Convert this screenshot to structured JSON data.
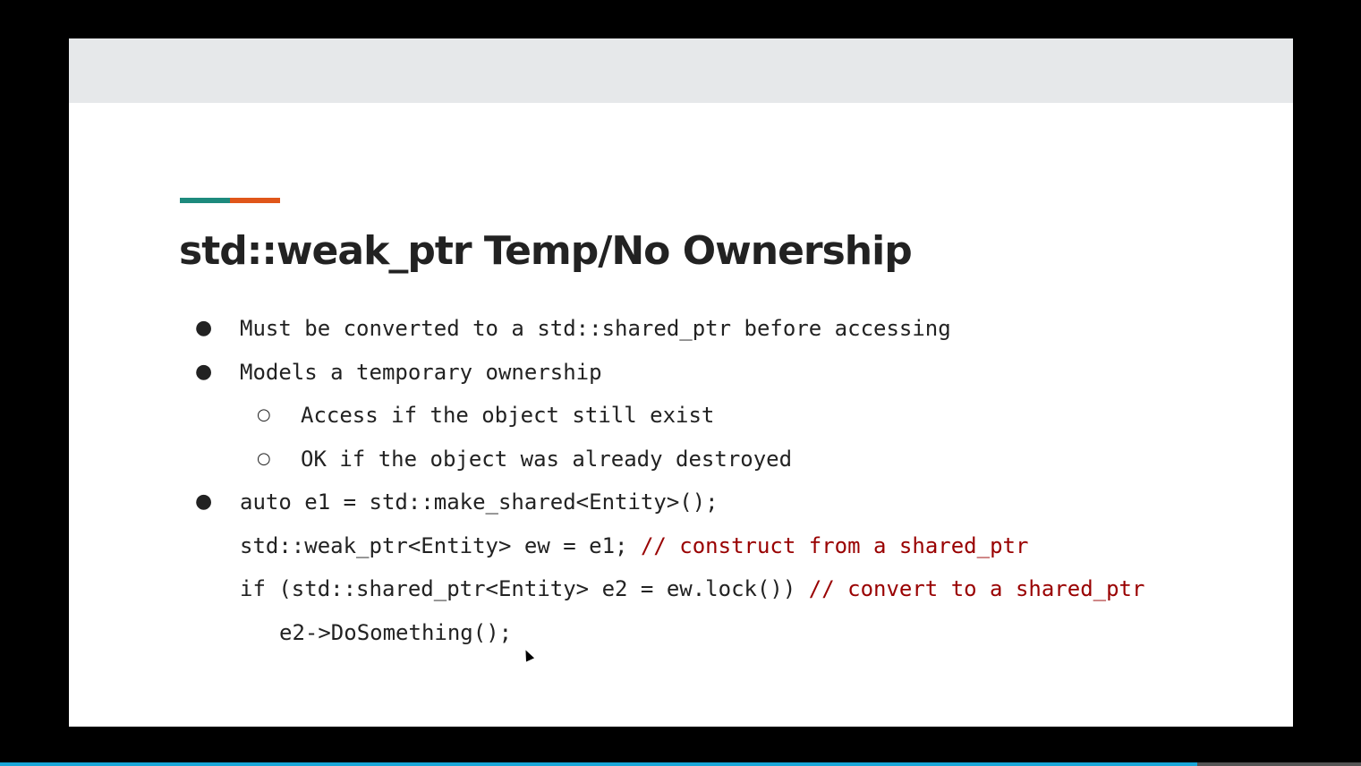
{
  "slide": {
    "title": "std::weak_ptr Temp/No Ownership",
    "bullets": [
      {
        "marker": "●",
        "text": "Must be converted to a std::shared_ptr before accessing"
      },
      {
        "marker": "●",
        "text": "Models a temporary ownership"
      },
      {
        "marker": "○",
        "text": "Access if the object still exist"
      },
      {
        "marker": "○",
        "text": "OK if the object was already destroyed"
      },
      {
        "marker": "●",
        "text": "auto e1 = std::make_shared<Entity>();"
      }
    ],
    "code": [
      {
        "code": "std::weak_ptr<Entity> ew = e1; ",
        "comment": "// construct from a shared_ptr"
      },
      {
        "code": "if (std::shared_ptr<Entity> e2 = ew.lock()) ",
        "comment": "// convert to a shared_ptr"
      },
      {
        "code": "e2->DoSomething();",
        "comment": ""
      }
    ]
  },
  "colors": {
    "accent_teal": "#1d8a7d",
    "accent_orange": "#e0561a",
    "comment_red": "#990000",
    "progress_blue": "#1aa7d9"
  },
  "icons": {
    "cursor": "mouse-pointer-icon"
  },
  "video_progress": {
    "fraction": 0.88
  }
}
